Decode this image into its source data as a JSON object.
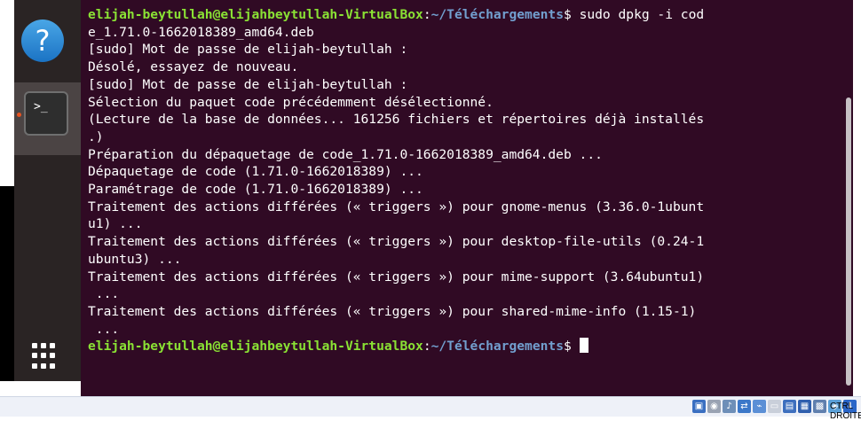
{
  "dock": {
    "help_icon_glyph": "?",
    "terminal_icon_glyph": ">_"
  },
  "terminal": {
    "prompt_user": "elijah-beytullah@elijahbeytullah-VirtualBox",
    "prompt_sep": ":",
    "prompt_path": "~/Téléchargements",
    "prompt_end": "$",
    "command": " sudo dpkg -i cod",
    "line_1": "e_1.71.0-1662018389_amd64.deb",
    "line_2": "[sudo] Mot de passe de elijah-beytullah :",
    "line_3": "Désolé, essayez de nouveau.",
    "line_4": "[sudo] Mot de passe de elijah-beytullah :",
    "line_5": "Sélection du paquet code précédemment désélectionné.",
    "line_6": "(Lecture de la base de données... 161256 fichiers et répertoires déjà installés",
    "line_7": ".)",
    "line_8": "Préparation du dépaquetage de code_1.71.0-1662018389_amd64.deb ...",
    "line_9": "Dépaquetage de code (1.71.0-1662018389) ...",
    "line_10": "Paramétrage de code (1.71.0-1662018389) ...",
    "line_11": "Traitement des actions différées (« triggers ») pour gnome-menus (3.36.0-1ubunt",
    "line_12": "u1) ...",
    "line_13": "Traitement des actions différées (« triggers ») pour desktop-file-utils (0.24-1",
    "line_14": "ubuntu3) ...",
    "line_15": "Traitement des actions différées (« triggers ») pour mime-support (3.64ubuntu1)",
    "line_16": " ...",
    "line_17": "Traitement des actions différées (« triggers ») pour shared-mime-info (1.15-1)",
    "line_18": " ...",
    "final_prompt_end": "$ "
  },
  "statusbar": {
    "host_key_label": "CTRL DROITE",
    "icons": [
      "hard-disk-icon",
      "optical-drive-icon",
      "audio-icon",
      "network-icon",
      "usb-icon",
      "shared-folders-icon",
      "display-icon",
      "video-capture-icon",
      "cpu-icon",
      "mouse-integration-icon",
      "keyboard-icon"
    ],
    "colors": {
      "accent": "#1b73c4",
      "terminal_bg": "#300a24",
      "prompt_user": "#8ae234",
      "prompt_path": "#729fcf"
    }
  }
}
